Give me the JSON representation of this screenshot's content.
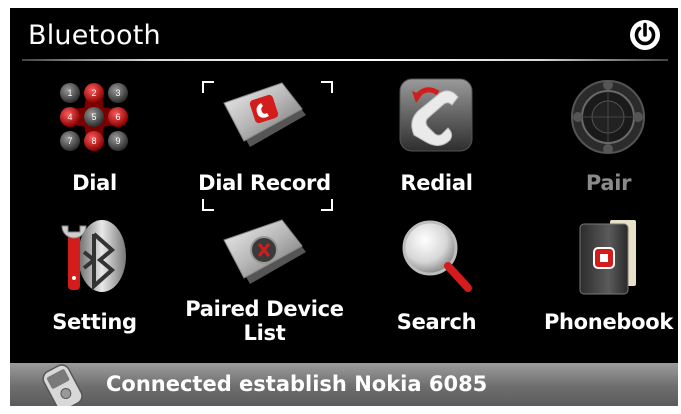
{
  "header": {
    "title": "Bluetooth",
    "power_icon": "power-icon"
  },
  "menu": {
    "dial": "Dial",
    "dial_record": "Dial Record",
    "redial": "Redial",
    "pair": "Pair",
    "setting": "Setting",
    "paired_device_list_line1": "Paired Device",
    "paired_device_list_line2": "List",
    "search": "Search",
    "phonebook": "Phonebook",
    "selected": "Dial Record",
    "disabled": [
      "Pair"
    ]
  },
  "dialpad_keys": [
    "1",
    "2",
    "3",
    "4",
    "5",
    "6",
    "7",
    "8",
    "9"
  ],
  "status": {
    "text": "Connected establish Nokia 6085"
  },
  "colors": {
    "accent_red": "#d31c1c",
    "background": "#000000",
    "disabled_text": "#8a8a8a"
  }
}
